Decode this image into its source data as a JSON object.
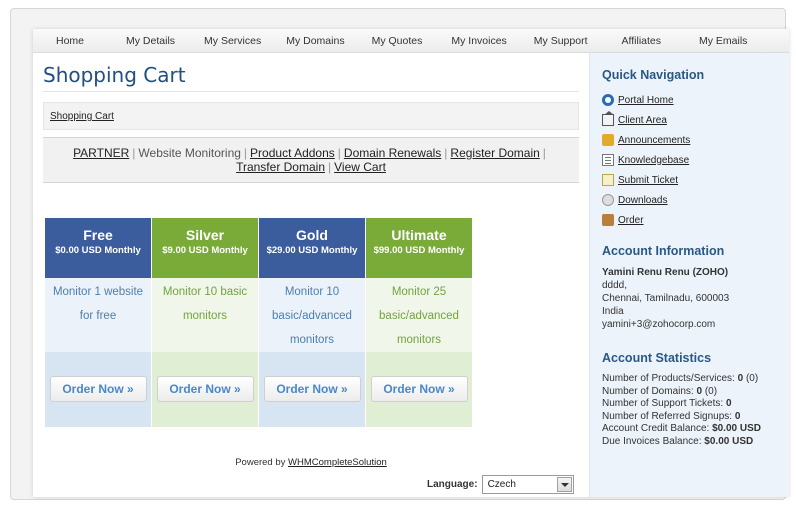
{
  "nav": [
    "Home",
    "My Details",
    "My Services",
    "My Domains",
    "My Quotes",
    "My Invoices",
    "My Support",
    "Affiliates",
    "My Emails"
  ],
  "page_title": "Shopping Cart",
  "breadcrumb": "Shopping Cart",
  "category_links": {
    "partner": "PARTNER",
    "website_monitoring": "Website Monitoring",
    "product_addons": "Product Addons",
    "domain_renewals": "Domain Renewals",
    "register_domain": "Register Domain",
    "transfer_domain": "Transfer Domain",
    "view_cart": "View Cart"
  },
  "plans": [
    {
      "name": "Free",
      "price": "$0.00 USD Monthly",
      "desc": "Monitor 1 website for free",
      "color": "#3b5d9e",
      "order": "Order Now »"
    },
    {
      "name": "Silver",
      "price": "$9.00 USD Monthly",
      "desc": "Monitor 10 basic monitors",
      "color": "#7aab39",
      "order": "Order Now »"
    },
    {
      "name": "Gold",
      "price": "$29.00 USD Monthly",
      "desc": "Monitor 10 basic/advanced monitors",
      "color": "#3b5d9e",
      "order": "Order Now »"
    },
    {
      "name": "Ultimate",
      "price": "$99.00 USD Monthly",
      "desc": "Monitor 25 basic/advanced monitors",
      "color": "#7aab39",
      "order": "Order Now »"
    }
  ],
  "footer": {
    "powered_prefix": "Powered by",
    "powered_link": "WHMCompleteSolution",
    "language_label": "Language:",
    "language_value": "Czech"
  },
  "sidebar": {
    "quick_nav_title": "Quick Navigation",
    "quick_nav": [
      {
        "label": "Portal Home",
        "icon": "portal-home-icon"
      },
      {
        "label": "Client Area",
        "icon": "client-area-icon"
      },
      {
        "label": "Announcements",
        "icon": "announcements-icon"
      },
      {
        "label": "Knowledgebase",
        "icon": "knowledgebase-icon"
      },
      {
        "label": "Submit Ticket",
        "icon": "submit-ticket-icon"
      },
      {
        "label": "Downloads",
        "icon": "downloads-icon"
      },
      {
        "label": "Order",
        "icon": "order-icon"
      }
    ],
    "account_info_title": "Account Information",
    "account": {
      "name": "Yamini Renu Renu (ZOHO)",
      "line1": "dddd,",
      "line2": "Chennai, Tamilnadu, 600003",
      "country": "India",
      "email": "yamini+3@zohocorp.com"
    },
    "stats_title": "Account Statistics",
    "stats": [
      {
        "label": "Number of Products/Services:",
        "value": "0",
        "extra": "(0)"
      },
      {
        "label": "Number of Domains:",
        "value": "0",
        "extra": "(0)"
      },
      {
        "label": "Number of Support Tickets:",
        "value": "0",
        "extra": ""
      },
      {
        "label": "Number of Referred Signups:",
        "value": "0",
        "extra": ""
      },
      {
        "label": "Account Credit Balance:",
        "value": "$0.00 USD",
        "extra": ""
      },
      {
        "label": "Due Invoices Balance:",
        "value": "$0.00 USD",
        "extra": ""
      }
    ]
  }
}
